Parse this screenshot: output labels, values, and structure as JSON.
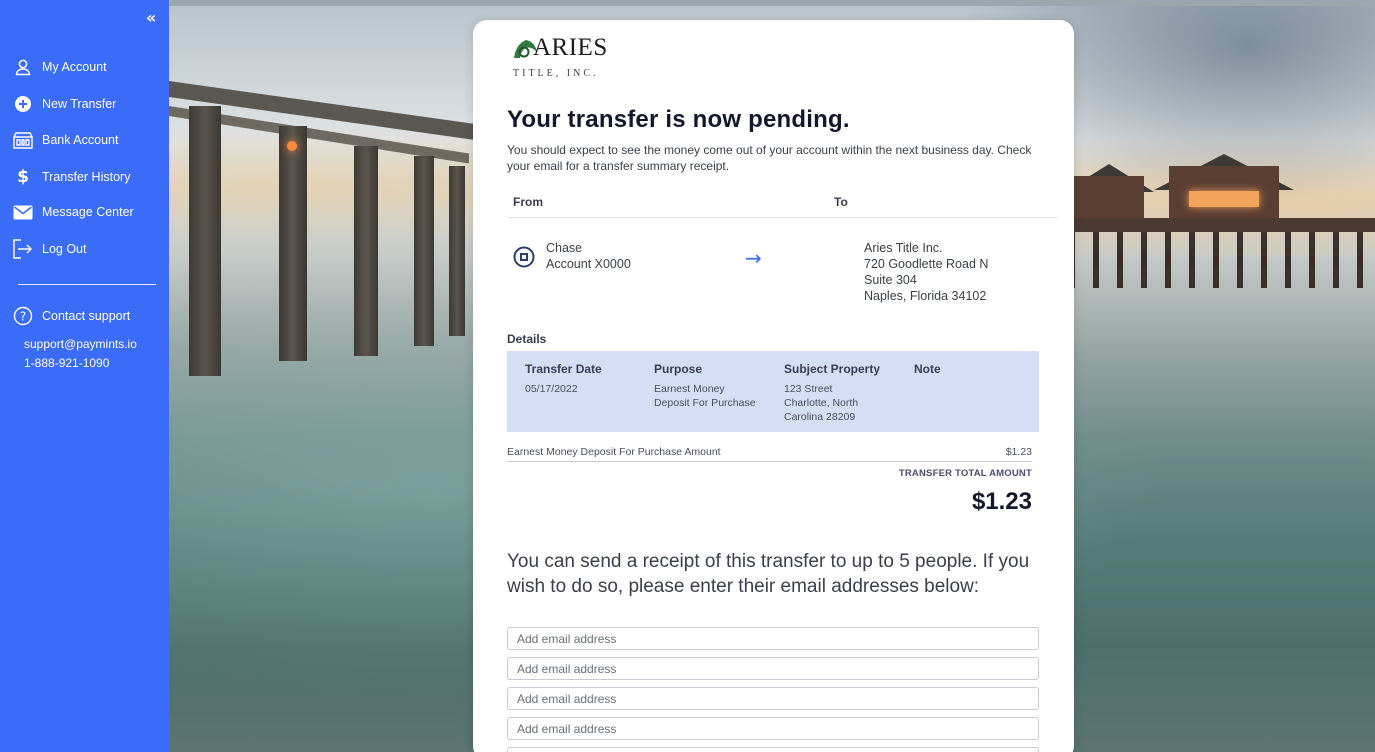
{
  "sidebar": {
    "collapse_label": "«",
    "items": [
      {
        "label": "My Account",
        "icon": "user-icon"
      },
      {
        "label": "New Transfer",
        "icon": "plus-circle-icon"
      },
      {
        "label": "Bank Account",
        "icon": "bank-icon"
      },
      {
        "label": "Transfer History",
        "icon": "dollar-icon"
      },
      {
        "label": "Message Center",
        "icon": "envelope-icon"
      },
      {
        "label": "Log Out",
        "icon": "logout-icon"
      }
    ],
    "support": {
      "label": "Contact support",
      "icon": "help-circle-icon",
      "email": "support@paymints.io",
      "phone": "1-888-921-1090"
    }
  },
  "logo": {
    "name": "ARIES",
    "sub": "TITLE, INC."
  },
  "main": {
    "title": "Your transfer is now pending.",
    "intro": "You should expect to see the money come out of your account within the next business day. Check your email for a transfer summary receipt.",
    "from_label": "From",
    "to_label": "To",
    "from": {
      "bank": "Chase",
      "account": "Account X0000",
      "icon": "bank-logo-icon"
    },
    "to": {
      "line1": "Aries Title Inc.",
      "line2": "720 Goodlette Road N",
      "line3": "Suite 304",
      "line4": "Naples, Florida 34102"
    },
    "details_label": "Details",
    "details": {
      "headers": [
        "Transfer Date",
        "Purpose",
        "Subject Property",
        "Note"
      ],
      "transfer_date": "05/17/2022",
      "purpose_1": "Earnest Money",
      "purpose_2": "Deposit For Purchase",
      "property_1": "123 Street",
      "property_2": "Charlotte, North",
      "property_3": "Carolina 28209",
      "note": ""
    },
    "amount_label": "Earnest Money Deposit For Purchase Amount",
    "amount_value": "$1.23",
    "total_label": "TRANSFER TOTAL AMOUNT",
    "total_value": "$1.23",
    "receipt_text": "You can send a receipt of this transfer to up to 5 people. If you wish to do so, please enter their email addresses below:",
    "email_placeholder": "Add email address"
  },
  "colors": {
    "accent": "#3b6cf8",
    "details_bg": "#d3dff5",
    "text_dark": "#14182a"
  }
}
